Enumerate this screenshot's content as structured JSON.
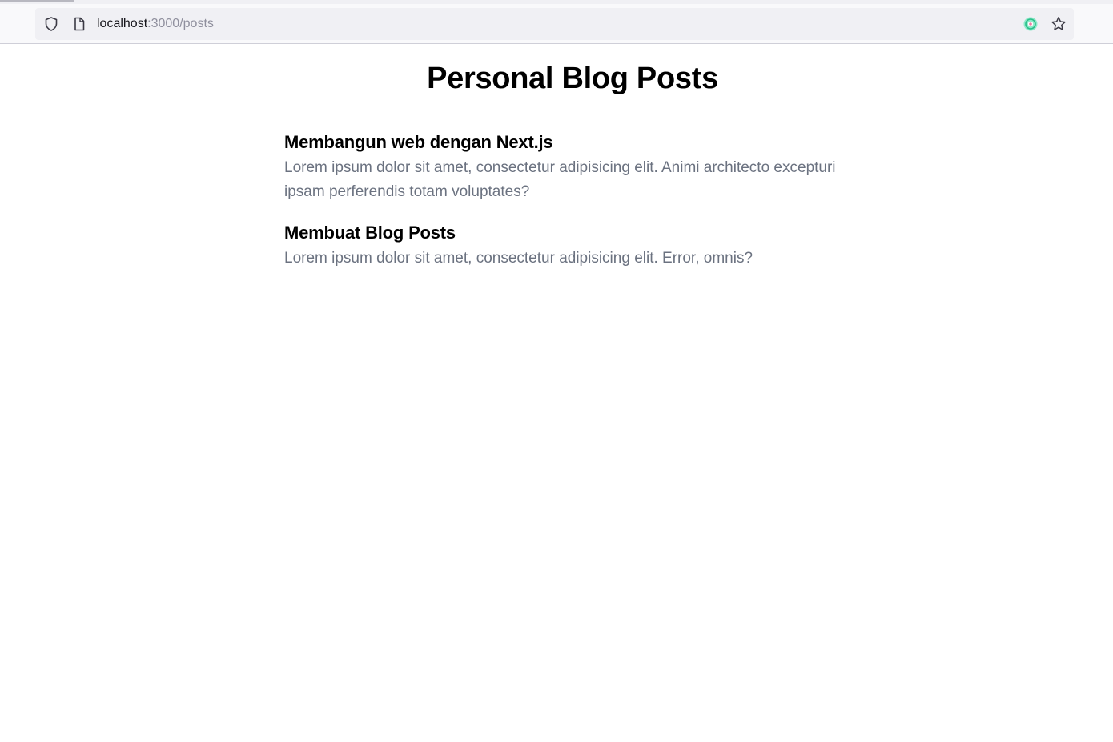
{
  "browser": {
    "url_host": "localhost",
    "url_path": ":3000/posts",
    "icons": [
      "shield-icon",
      "page-icon",
      "extension-icon",
      "bookmark-star-icon"
    ]
  },
  "page": {
    "title": "Personal Blog Posts",
    "posts": [
      {
        "title": "Membangun web dengan Next.js",
        "excerpt": "Lorem ipsum dolor sit amet, consectetur adipisicing elit. Animi architecto excepturi ipsam perferendis totam voluptates?"
      },
      {
        "title": "Membuat Blog Posts",
        "excerpt": "Lorem ipsum dolor sit amet, consectetur adipisicing elit. Error, omnis?"
      }
    ]
  },
  "colors": {
    "heading": "#000000",
    "excerpt": "#6b7280",
    "url_path": "#8f8f9d"
  }
}
